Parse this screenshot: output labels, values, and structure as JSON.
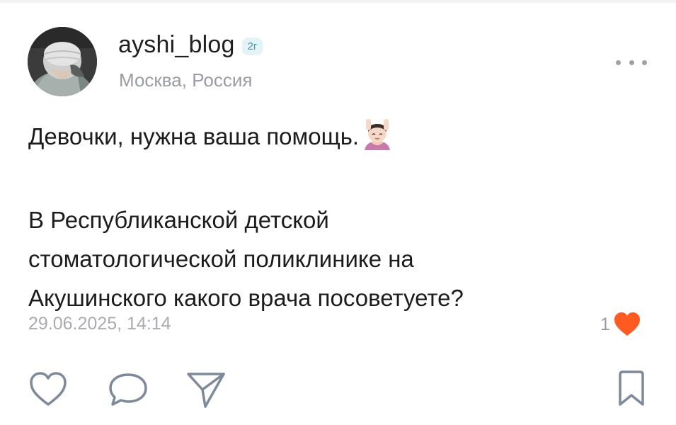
{
  "post": {
    "author": {
      "username": "ayshi_blog",
      "age_badge": "2г",
      "location": "Москва, Россия"
    },
    "text_lines": [
      "Девочки, нужна ваша помощь.",
      "В Республиканской детской",
      "стоматологической поликлинике на",
      "Акушинского какого врача посоветуете?"
    ],
    "timestamp": "29.06.2025, 14:14",
    "likes_count": "1"
  },
  "icons": {
    "more": "more-dots-icon",
    "like_filled": "heart-filled-icon",
    "like": "heart-outline-icon",
    "comment": "speech-bubble-icon",
    "share": "send-arrow-icon",
    "bookmark": "bookmark-icon",
    "emoji": "woman-getting-massage-emoji"
  },
  "colors": {
    "accent_heart": "#ff5a22",
    "badge_bg": "#e3f3f7",
    "badge_text": "#3a9bb2",
    "secondary_text": "#9a9ca3",
    "icon_gray": "#7d8a99"
  }
}
